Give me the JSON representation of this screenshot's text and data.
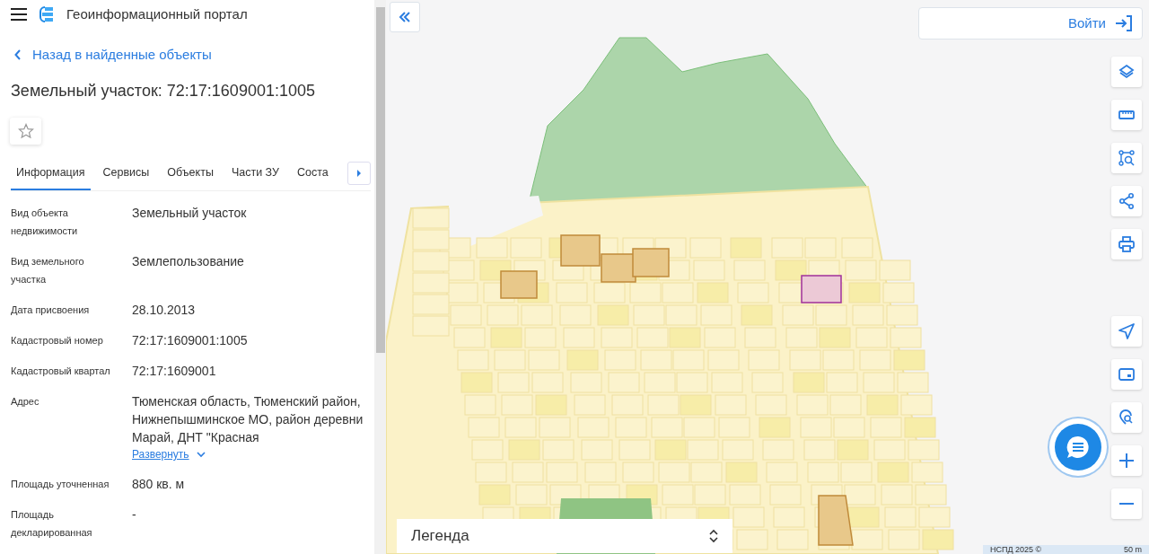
{
  "header": {
    "title": "Геоинформационный портал"
  },
  "back_link": "Назад в найденные объекты",
  "object_title": "Земельный участок: 72:17:1609001:1005",
  "favorite": {
    "on": false
  },
  "tabs": [
    {
      "label": "Информация",
      "selected": true
    },
    {
      "label": "Сервисы",
      "selected": false
    },
    {
      "label": "Объекты",
      "selected": false
    },
    {
      "label": "Части ЗУ",
      "selected": false
    },
    {
      "label": "Соста",
      "selected": false
    }
  ],
  "fields": [
    {
      "label": "Вид объекта недвижимости",
      "value": "Земельный участок"
    },
    {
      "label": "Вид земельного участка",
      "value": "Землепользование"
    },
    {
      "label": "Дата присвоения",
      "value": "28.10.2013"
    },
    {
      "label": "Кадастровый номер",
      "value": "72:17:1609001:1005"
    },
    {
      "label": "Кадастровый квартал",
      "value": "72:17:1609001"
    },
    {
      "label": "Адрес",
      "value": "Тюменская область, Тюменский район, Нижнепышминское МО, район деревни Марай, ДНТ \"Красная",
      "expand_link": "Развернуть"
    },
    {
      "label": "Площадь уточненная",
      "value": "880 кв. м"
    },
    {
      "label": "Площадь декларированная",
      "value": "-"
    }
  ],
  "map": {
    "login_button": "Войти",
    "tools": [
      {
        "kind": "layers"
      },
      {
        "kind": "ruler"
      },
      {
        "kind": "select"
      },
      {
        "kind": "share"
      },
      {
        "kind": "print"
      }
    ],
    "nav_tools": [
      {
        "kind": "locate"
      },
      {
        "kind": "minimap"
      },
      {
        "kind": "search-location"
      },
      {
        "kind": "zoom-in"
      },
      {
        "kind": "zoom-out"
      }
    ],
    "legend": "Легенда",
    "attribution": "НСПД 2025 ©",
    "scale": "50 m"
  }
}
